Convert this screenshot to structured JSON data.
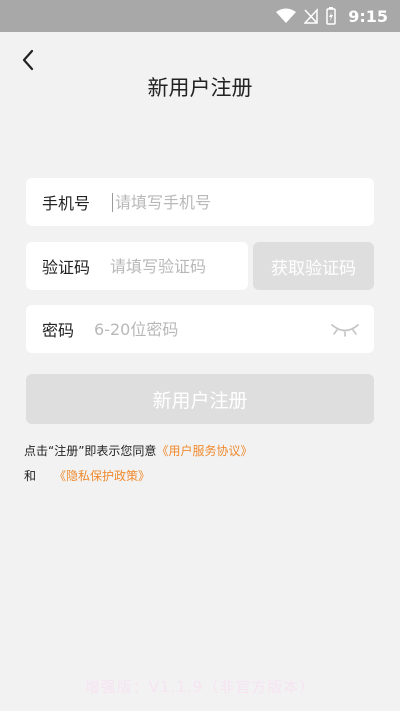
{
  "status_bar": {
    "time": "9:15",
    "icons": [
      "wifi-icon",
      "no-signal-icon",
      "battery-charging-icon"
    ]
  },
  "header": {
    "back_icon": "chevron-left-icon",
    "title": "新用户注册"
  },
  "form": {
    "phone": {
      "label": "手机号",
      "placeholder": "请填写手机号"
    },
    "code": {
      "label": "验证码",
      "placeholder": "请填写验证码",
      "get_code_label": "获取验证码"
    },
    "password": {
      "label": "密码",
      "placeholder": "6-20位密码",
      "eye_icon": "eye-closed-icon"
    },
    "submit_label": "新用户注册"
  },
  "agreement": {
    "prefix": "点击“注册”即表示您同意",
    "service_link": "《用户服务协议》",
    "and": "和",
    "privacy_link": "《隐私保护政策》"
  },
  "watermark": "增强版：V1.1.9（非官方版本）",
  "colors": {
    "background": "#f2f2f2",
    "status_bar": "#a8a8a8",
    "disabled_button": "#dedede",
    "link": "#f08a2e"
  }
}
